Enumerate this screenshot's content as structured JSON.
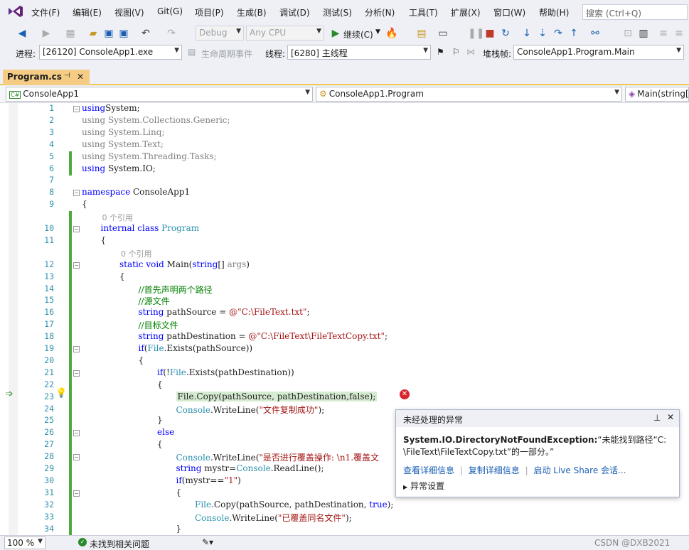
{
  "menu": {
    "items": [
      "文件(F)",
      "编辑(E)",
      "视图(V)",
      "Git(G)",
      "项目(P)",
      "生成(B)",
      "调试(D)",
      "测试(S)",
      "分析(N)",
      "工具(T)",
      "扩展(X)",
      "窗口(W)",
      "帮助(H)"
    ],
    "search_placeholder": "搜索 (Ctrl+Q)"
  },
  "toolbar": {
    "config": "Debug",
    "platform": "Any CPU",
    "continue_label": "继续(C)"
  },
  "debugbar": {
    "process_label": "进程:",
    "process_value": "[26120] ConsoleApp1.exe",
    "lifecycle_label": "生命周期事件",
    "thread_label": "线程:",
    "thread_value": "[6280] 主线程",
    "stackframe_label": "堆栈帧:",
    "stackframe_value": "ConsoleApp1.Program.Main"
  },
  "tab": {
    "title": "Program.cs",
    "pin": "⊣",
    "close": "✕"
  },
  "navbar": {
    "project": "ConsoleApp1",
    "class": "ConsoleApp1.Program",
    "member": "Main(string["
  },
  "editor": {
    "lines": [
      {
        "n": "1",
        "indent": 0,
        "tokens": [
          [
            "kw",
            "using"
          ],
          [
            "",
            "System;"
          ]
        ]
      },
      {
        "n": "2",
        "indent": 0,
        "tokens": [
          [
            "gr",
            "using System.Collections.Generic;"
          ]
        ]
      },
      {
        "n": "3",
        "indent": 0,
        "tokens": [
          [
            "gr",
            "using System.Linq;"
          ]
        ]
      },
      {
        "n": "4",
        "indent": 0,
        "tokens": [
          [
            "gr",
            "using System.Text;"
          ]
        ]
      },
      {
        "n": "5",
        "indent": 0,
        "tokens": [
          [
            "gr",
            "using System.Threading.Tasks;"
          ]
        ]
      },
      {
        "n": "6",
        "indent": 0,
        "tokens": [
          [
            "kw",
            "using"
          ],
          [
            "",
            " System.IO;"
          ]
        ]
      },
      {
        "n": "7",
        "indent": 0,
        "tokens": []
      },
      {
        "n": "8",
        "indent": 0,
        "tokens": [
          [
            "kw",
            "namespace"
          ],
          [
            "",
            " ConsoleApp1"
          ]
        ]
      },
      {
        "n": "9",
        "indent": 0,
        "tokens": [
          [
            "",
            "{"
          ]
        ]
      },
      {
        "n": "",
        "indent": 1,
        "ref": "0 个引用"
      },
      {
        "n": "10",
        "indent": 1,
        "tokens": [
          [
            "kw",
            "internal class "
          ],
          [
            "ty",
            "Program"
          ]
        ]
      },
      {
        "n": "11",
        "indent": 1,
        "tokens": [
          [
            "",
            "{"
          ]
        ]
      },
      {
        "n": "",
        "indent": 2,
        "ref": "0 个引用"
      },
      {
        "n": "12",
        "indent": 2,
        "tokens": [
          [
            "kw",
            "static void "
          ],
          [
            "",
            "Main("
          ],
          [
            "kw",
            "string"
          ],
          [
            "",
            "[] "
          ],
          [
            "gr",
            "args"
          ],
          [
            "",
            ")"
          ]
        ]
      },
      {
        "n": "13",
        "indent": 2,
        "tokens": [
          [
            "",
            "{"
          ]
        ]
      },
      {
        "n": "14",
        "indent": 3,
        "tokens": [
          [
            "cm",
            "//首先声明两个路径"
          ]
        ]
      },
      {
        "n": "15",
        "indent": 3,
        "tokens": [
          [
            "cm",
            "//源文件"
          ]
        ]
      },
      {
        "n": "16",
        "indent": 3,
        "tokens": [
          [
            "kw",
            "string"
          ],
          [
            "",
            " pathSource = "
          ],
          [
            "st",
            "@\"C:\\FileText.txt\""
          ],
          [
            "",
            ";"
          ]
        ]
      },
      {
        "n": "17",
        "indent": 3,
        "tokens": [
          [
            "cm",
            "//目标文件"
          ]
        ]
      },
      {
        "n": "18",
        "indent": 3,
        "tokens": [
          [
            "kw",
            "string"
          ],
          [
            "",
            " pathDestination = "
          ],
          [
            "st",
            "@\"C:\\FileText\\FileTextCopy.txt\""
          ],
          [
            "",
            ";"
          ]
        ]
      },
      {
        "n": "19",
        "indent": 3,
        "tokens": [
          [
            "kw",
            "if"
          ],
          [
            "",
            "("
          ],
          [
            "ty",
            "File"
          ],
          [
            "",
            ".Exists(pathSource))"
          ]
        ]
      },
      {
        "n": "20",
        "indent": 3,
        "tokens": [
          [
            "",
            "{"
          ]
        ]
      },
      {
        "n": "21",
        "indent": 4,
        "tokens": [
          [
            "kw",
            "if"
          ],
          [
            "",
            "(!"
          ],
          [
            "ty",
            "File"
          ],
          [
            "",
            ".Exists(pathDestination))"
          ]
        ]
      },
      {
        "n": "22",
        "indent": 4,
        "tokens": [
          [
            "",
            "{"
          ]
        ]
      },
      {
        "n": "23",
        "indent": 5,
        "tokens": [
          [
            "",
            "File.Copy(pathSource, pathDestination,false);"
          ]
        ],
        "current": true
      },
      {
        "n": "24",
        "indent": 5,
        "tokens": [
          [
            "ty",
            "Console"
          ],
          [
            "",
            ".WriteLine("
          ],
          [
            "st",
            "\"文件复制成功\""
          ],
          [
            "",
            ");"
          ]
        ]
      },
      {
        "n": "25",
        "indent": 4,
        "tokens": [
          [
            "",
            "}"
          ]
        ]
      },
      {
        "n": "26",
        "indent": 4,
        "tokens": [
          [
            "kw",
            "else"
          ]
        ]
      },
      {
        "n": "27",
        "indent": 4,
        "tokens": [
          [
            "",
            "{"
          ]
        ]
      },
      {
        "n": "28",
        "indent": 5,
        "tokens": [
          [
            "ty",
            "Console"
          ],
          [
            "",
            ".WriteLine("
          ],
          [
            "st",
            "\"是否进行覆盖操作: \\n1.覆盖文"
          ]
        ]
      },
      {
        "n": "29",
        "indent": 5,
        "tokens": [
          [
            "kw",
            "string"
          ],
          [
            "",
            " mystr="
          ],
          [
            "ty",
            "Console"
          ],
          [
            "",
            ".ReadLine();"
          ]
        ]
      },
      {
        "n": "30",
        "indent": 5,
        "tokens": [
          [
            "kw",
            "if"
          ],
          [
            "",
            "(mystr=="
          ],
          [
            "st",
            "\"1\""
          ],
          [
            "",
            ")"
          ]
        ]
      },
      {
        "n": "31",
        "indent": 5,
        "tokens": [
          [
            "",
            "{"
          ]
        ]
      },
      {
        "n": "32",
        "indent": 6,
        "tokens": [
          [
            "ty",
            "File"
          ],
          [
            "",
            ".Copy(pathSource, pathDestination, "
          ],
          [
            "kw",
            "true"
          ],
          [
            "",
            ");"
          ]
        ]
      },
      {
        "n": "33",
        "indent": 6,
        "tokens": [
          [
            "ty",
            "Console"
          ],
          [
            "",
            ".WriteLine("
          ],
          [
            "st",
            "\"已覆盖同名文件\""
          ],
          [
            "",
            ");"
          ]
        ]
      },
      {
        "n": "34",
        "indent": 5,
        "tokens": [
          [
            "",
            "}"
          ]
        ]
      }
    ]
  },
  "exception": {
    "title": "未经处理的异常",
    "type": "System.IO.DirectoryNotFoundException:",
    "message_head": "“未能找到路径“C:",
    "message_tail": "\\FileText\\FileTextCopy.txt”的一部分。”",
    "link_details": "查看详细信息",
    "link_copy": "复制详细信息",
    "link_liveshare": "启动 Live Share 会话...",
    "settings": "异常设置"
  },
  "status": {
    "zoom": "100 %",
    "issues": "未找到相关问题",
    "watermark": "CSDN @DXB2021"
  }
}
